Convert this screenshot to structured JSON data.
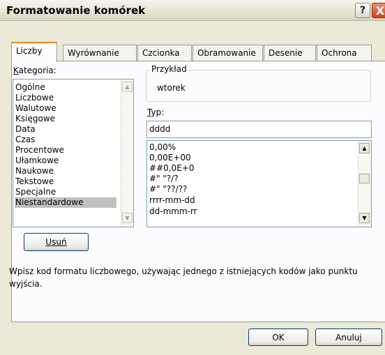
{
  "window": {
    "title": "Formatowanie komórek",
    "help_glyph": "?",
    "close_glyph": "X"
  },
  "tabs": [
    {
      "label": "Liczby"
    },
    {
      "label": "Wyrównanie"
    },
    {
      "label": "Czcionka"
    },
    {
      "label": "Obramowanie"
    },
    {
      "label": "Desenie"
    },
    {
      "label": "Ochrona"
    }
  ],
  "category": {
    "label": "Kategoria:",
    "items": [
      "Ogólne",
      "Liczbowe",
      "Walutowe",
      "Księgowe",
      "Data",
      "Czas",
      "Procentowe",
      "Ułamkowe",
      "Naukowe",
      "Tekstowe",
      "Specjalne",
      "Niestandardowe"
    ],
    "selected": "Niestandardowe"
  },
  "sample": {
    "label": "Przykład",
    "value": "wtorek"
  },
  "type": {
    "label": "Typ:",
    "value": "dddd",
    "formats": [
      "0,00%",
      "0,00E+00",
      "##0,0E+0",
      "#\" \"?/?",
      "#\" \"??/??",
      "rrrr-mm-dd",
      "dd-mmm-rr"
    ]
  },
  "delete_button": "Usuń",
  "description": "Wpisz kod formatu liczbowego, używając jednego z istniejących kodów jako punktu wyjścia.",
  "ok_button": "OK",
  "cancel_button": "Anuluj"
}
